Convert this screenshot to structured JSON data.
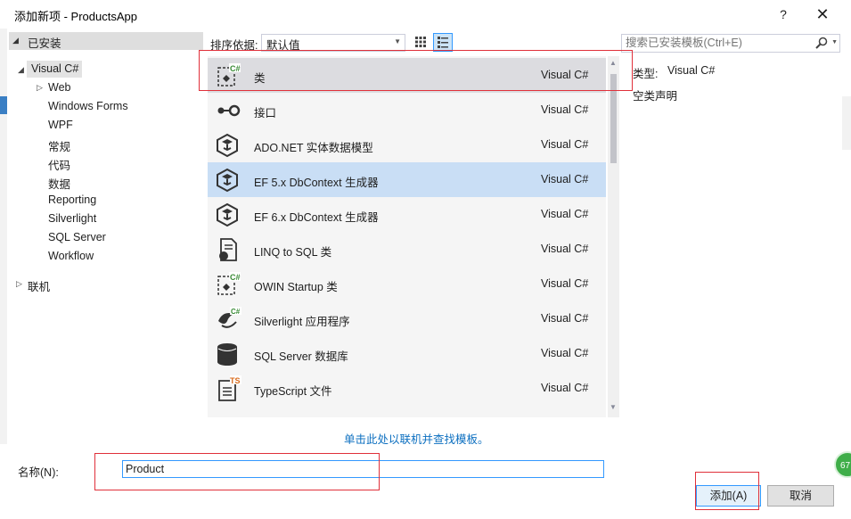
{
  "window": {
    "title": "添加新项 - ProductsApp",
    "help_label": "?",
    "close_label": "✕"
  },
  "tree": {
    "installed_label": "已安装",
    "root_label": "Visual C#",
    "children": [
      "Web",
      "Windows Forms",
      "WPF",
      "常规",
      "代码",
      "数据",
      "Reporting",
      "Silverlight",
      "SQL Server",
      "Workflow"
    ],
    "online_label": "联机"
  },
  "toolbar": {
    "sort_label": "排序依据:",
    "sort_value": "默认值",
    "search_placeholder": "搜索已安装模板(Ctrl+E)"
  },
  "templates": [
    {
      "name": "类",
      "lang": "Visual C#",
      "icon": "class-icon",
      "state": "selected"
    },
    {
      "name": "接口",
      "lang": "Visual C#",
      "icon": "interface-icon"
    },
    {
      "name": "ADO.NET 实体数据模型",
      "lang": "Visual C#",
      "icon": "entity-model-icon"
    },
    {
      "name": "EF 5.x DbContext 生成器",
      "lang": "Visual C#",
      "icon": "entity-model-icon",
      "state": "hover"
    },
    {
      "name": "EF 6.x DbContext 生成器",
      "lang": "Visual C#",
      "icon": "entity-model-icon"
    },
    {
      "name": "LINQ to SQL 类",
      "lang": "Visual C#",
      "icon": "linq-icon"
    },
    {
      "name": "OWIN Startup 类",
      "lang": "Visual C#",
      "icon": "class-icon"
    },
    {
      "name": "Silverlight 应用程序",
      "lang": "Visual C#",
      "icon": "silverlight-icon"
    },
    {
      "name": "SQL Server 数据库",
      "lang": "Visual C#",
      "icon": "database-icon"
    },
    {
      "name": "TypeScript 文件",
      "lang": "Visual C#",
      "icon": "typescript-icon"
    }
  ],
  "detail": {
    "type_label": "类型:",
    "type_value": "Visual C#",
    "description": "空类声明"
  },
  "online_link": "单击此处以联机并查找模板。",
  "name_field": {
    "label": "名称(N):",
    "value": "Product"
  },
  "buttons": {
    "add": "添加(A)",
    "cancel": "取消"
  },
  "badge_text": "67",
  "colors": {
    "selection_blue": "#c9def5",
    "selection_gray": "#dcdce0",
    "accent": "#3399ff",
    "annotation_red": "#e0303a",
    "link": "#0e70c0"
  }
}
